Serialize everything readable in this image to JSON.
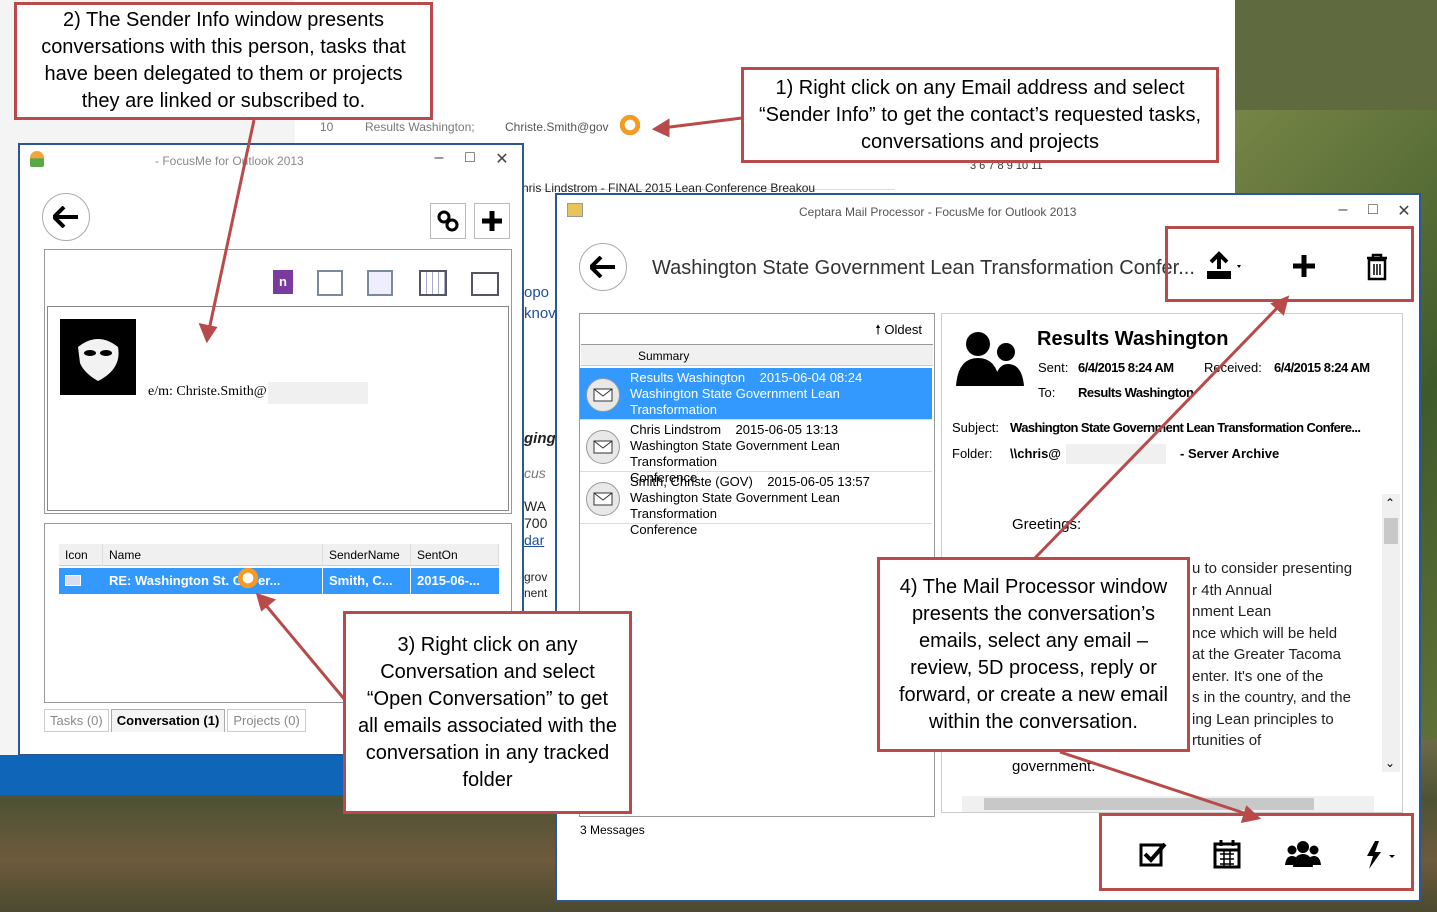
{
  "background": {
    "email_recipients": "Results Washington;",
    "email_recipient2": "Christe.Smith@gov",
    "email_num": "10",
    "email_subject": "hris Lindstrom - FINAL 2015 Lean Conference Breakou",
    "calendar_days": "3      6      7      8      9     10     11",
    "side_fragments": [
      "opo",
      "knov",
      "ging",
      "cus",
      "WA",
      "700",
      "dar",
      "grov",
      "nent"
    ]
  },
  "sender_window": {
    "title": "- FocusMe for Outlook 2013",
    "contact_label": "e/m: Christe.Smith@",
    "table_headers": [
      "Icon",
      "Name",
      "SenderName",
      "SentOn"
    ],
    "row": {
      "name": "RE: Washington St. Gover...",
      "sender": "Smith, C...",
      "sent": "2015-06-..."
    },
    "tabs": [
      "Tasks (0)",
      "Conversation (1)",
      "Projects (0)"
    ],
    "icons": [
      "onenote-icon",
      "tasks-icon",
      "delegate-icon",
      "calendar-icon",
      "contact-card-icon"
    ]
  },
  "mail_window": {
    "title": "Ceptara Mail Processor - FocusMe for Outlook 2013",
    "conversation_title": "Washington State Government Lean Transformation Confer...",
    "sort_label": "Oldest",
    "list_header": "Summary",
    "messages": [
      {
        "sender": "Results Washington",
        "date": "2015-06-04 08:24",
        "subject": "Washington State Government Lean Transformation",
        "subject2": "Conference",
        "selected": true
      },
      {
        "sender": "Chris Lindstrom",
        "date": "2015-06-05 13:13",
        "subject": "Washington State Government Lean Transformation",
        "subject2": "Conference",
        "selected": false
      },
      {
        "sender": "Smith, Christe (GOV)",
        "date": "2015-06-05 13:57",
        "subject": "Washington State Government Lean Transformation",
        "subject2": "Conference",
        "selected": false
      }
    ],
    "count": "3 Messages",
    "preview": {
      "from": "Results Washington",
      "sent_label": "Sent:",
      "sent": "6/4/2015 8:24 AM",
      "received_label": "Received:",
      "received": "6/4/2015 8:24 AM",
      "to_label": "To:",
      "to": "Results Washington",
      "subject_label": "Subject:",
      "subject": "Washington State Government Lean Transformation Confere...",
      "folder_label": "Folder:",
      "folder": "\\\\chris@",
      "folder_suffix": "- Server Archive",
      "greeting": "Greetings:",
      "body_lines": [
        "u to consider presenting",
        "r 4th Annual",
        "nment Lean",
        "nce which will be held",
        "at the Greater Tacoma",
        "enter. It's one of the",
        "s in the country, and the",
        "ing Lean principles to",
        "rtunities of"
      ],
      "body_last": "government."
    }
  },
  "callouts": {
    "c1": "1) Right click on any Email address and select “Sender Info” to get the contact’s requested tasks, conversations and projects",
    "c2": "2) The Sender Info window presents conversations with this person, tasks that have been delegated to them or projects they are linked or subscribed to.",
    "c3": "3) Right click on any Conversation and select “Open Conversation” to get all emails associated with the conversation in any tracked folder",
    "c4": "4) The Mail Processor window presents the conversation’s emails, select any email – review, 5D process, reply or forward, or create a new email within the conversation."
  },
  "colors": {
    "callout_border": "#b84a4a",
    "window_border": "#2b5797",
    "selection": "#3399ff"
  }
}
